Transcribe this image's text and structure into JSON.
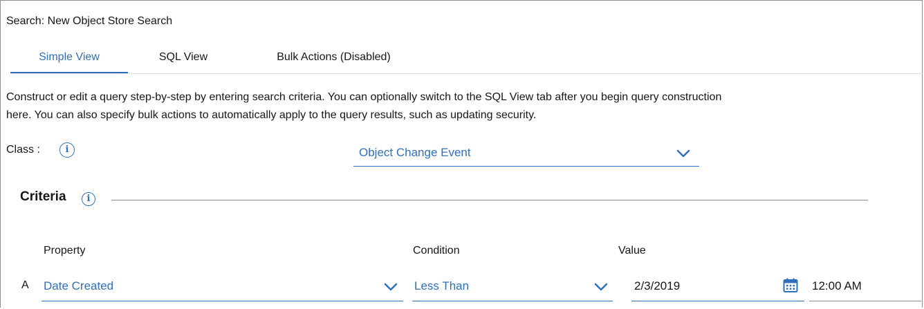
{
  "window": {
    "title": "Search: New Object Store Search"
  },
  "tabs": [
    {
      "label": "Simple View",
      "active": true
    },
    {
      "label": "SQL View",
      "active": false
    },
    {
      "label": "Bulk Actions (Disabled)",
      "active": false
    }
  ],
  "description": {
    "line1": "Construct or edit a query step-by-step by entering search criteria. You can optionally switch to the SQL View tab after you begin query construction",
    "line2": "here. You can also specify bulk actions to automatically apply to the query results, such as updating security."
  },
  "class_field": {
    "label": "Class :",
    "info_icon": "info-icon",
    "value": "Object Change Event",
    "dropdown_icon": "chevron-down-icon"
  },
  "criteria": {
    "title": "Criteria",
    "info_icon": "info-icon",
    "columns": {
      "property": "Property",
      "condition": "Condition",
      "value": "Value"
    },
    "rows": [
      {
        "letter": "A",
        "property": "Date Created",
        "condition": "Less Than",
        "date_value": "2/3/2019",
        "time_value": "12:00 AM",
        "calendar_icon": "calendar-icon"
      }
    ]
  },
  "colors": {
    "accent": "#2f6fbd",
    "text": "#161616",
    "divider": "#8d8d8d"
  }
}
